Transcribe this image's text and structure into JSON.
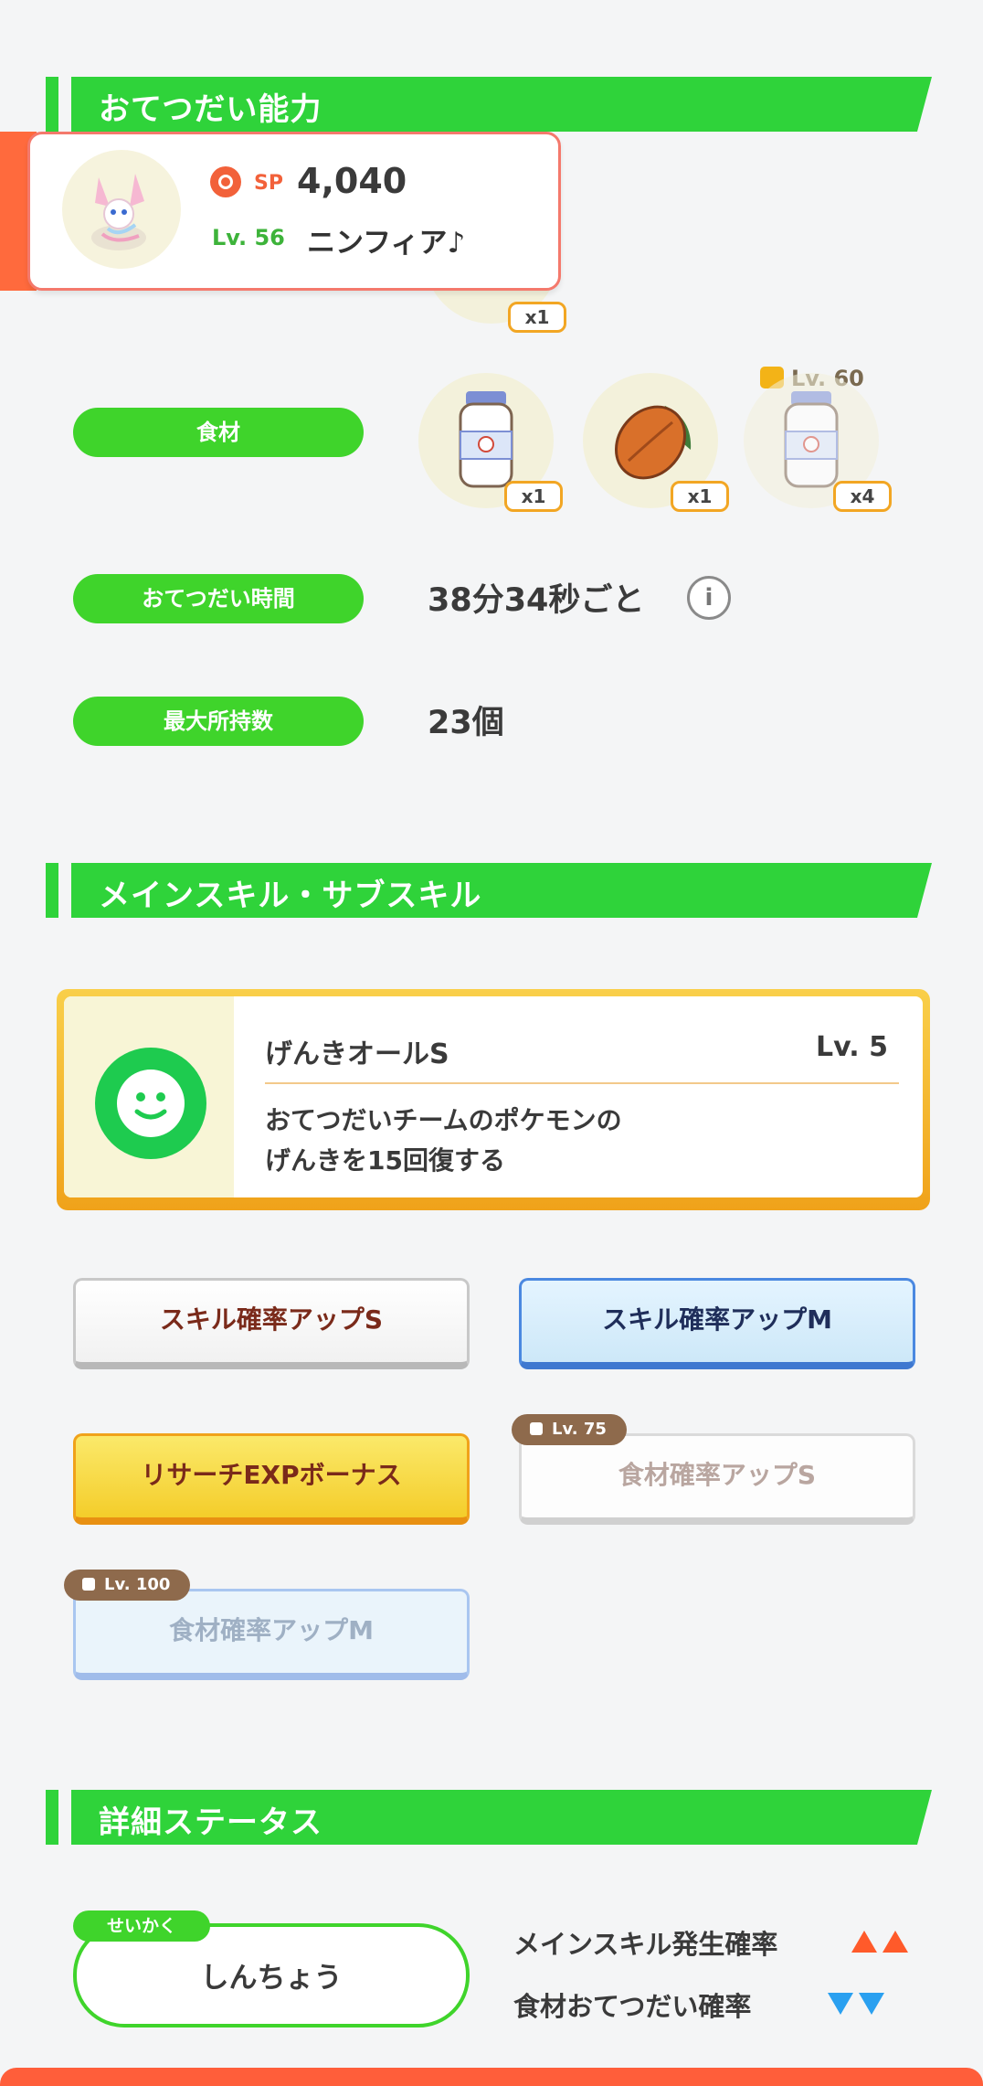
{
  "sections": {
    "ability": "おてつだい能力",
    "skills": "メインスキル・サブスキル",
    "details": "詳細ステータス"
  },
  "profile": {
    "sp_label": "SP",
    "sp_value": "4,040",
    "level_label": "Lv. 56",
    "name": "ニンフィア♪"
  },
  "peek_badge": "x1",
  "ingredients": {
    "label": "食材",
    "items": [
      {
        "icon": "milk-bottle-icon",
        "count": "x1"
      },
      {
        "icon": "cacao-icon",
        "count": "x1"
      },
      {
        "icon": "milk-bottle-icon",
        "count": "x4",
        "lock": "Lv. 60"
      }
    ]
  },
  "help_time": {
    "label": "おてつだい時間",
    "value": "38分34秒ごと",
    "info_glyph": "i"
  },
  "max_carry": {
    "label": "最大所持数",
    "value": "23個"
  },
  "main_skill": {
    "name": "げんきオールS",
    "level": "Lv. 5",
    "desc_line1": "おてつだいチームのポケモンの",
    "desc_line2": "げんきを15回復する"
  },
  "sub_skills": [
    {
      "label": "スキル確率アップS"
    },
    {
      "label": "スキル確率アップM"
    },
    {
      "label": "リサーチEXPボーナス"
    },
    {
      "label": "食材確率アップS",
      "lock": "Lv. 75"
    },
    {
      "label": "食材確率アップM",
      "lock": "Lv. 100"
    }
  ],
  "nature": {
    "tag": "せいかく",
    "value": "しんちょう",
    "up_stat": "メインスキル発生確率",
    "down_stat": "食材おてつだい確率"
  },
  "colors": {
    "green": "#2fd33a",
    "orange": "#ff6a3d",
    "gold": "#f0a21a",
    "blue": "#4a88e0"
  }
}
